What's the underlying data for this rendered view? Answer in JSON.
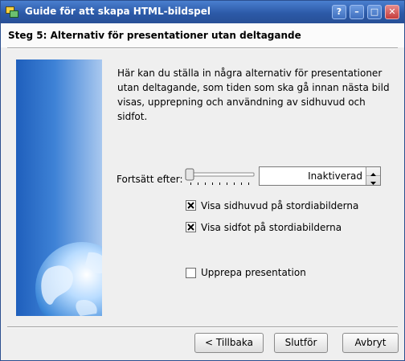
{
  "window": {
    "title": "Guide för att skapa HTML-bildspel",
    "buttons": {
      "help": "?",
      "minimize": "–",
      "maximize": "□",
      "close": "✕"
    }
  },
  "step": {
    "title": "Steg 5: Alternativ för presentationer utan deltagande"
  },
  "description": {
    "line1": "Här kan du ställa in några alternativ för presentationer",
    "line2": "utan deltagande, som tiden som ska gå innan nästa bild",
    "line3": "visas, upprepning och användning av sidhuvud och",
    "line4": "sidfot."
  },
  "continue_after": {
    "label": "Fortsätt efter:",
    "slider_fraction": 0.0,
    "value": "Inaktiverad"
  },
  "options": {
    "show_header": {
      "label": "Visa sidhuvud på stordiabilderna",
      "checked": true
    },
    "show_footer": {
      "label": "Visa sidfot på stordiabilderna",
      "checked": true
    },
    "repeat": {
      "label": "Upprepa presentation",
      "checked": false
    }
  },
  "footer_buttons": {
    "back": "< Tillbaka",
    "finish": "Slutför",
    "cancel": "Avbryt"
  },
  "colors": {
    "titlebar": "#2c5aa8",
    "side_image": "#3e82d6"
  }
}
